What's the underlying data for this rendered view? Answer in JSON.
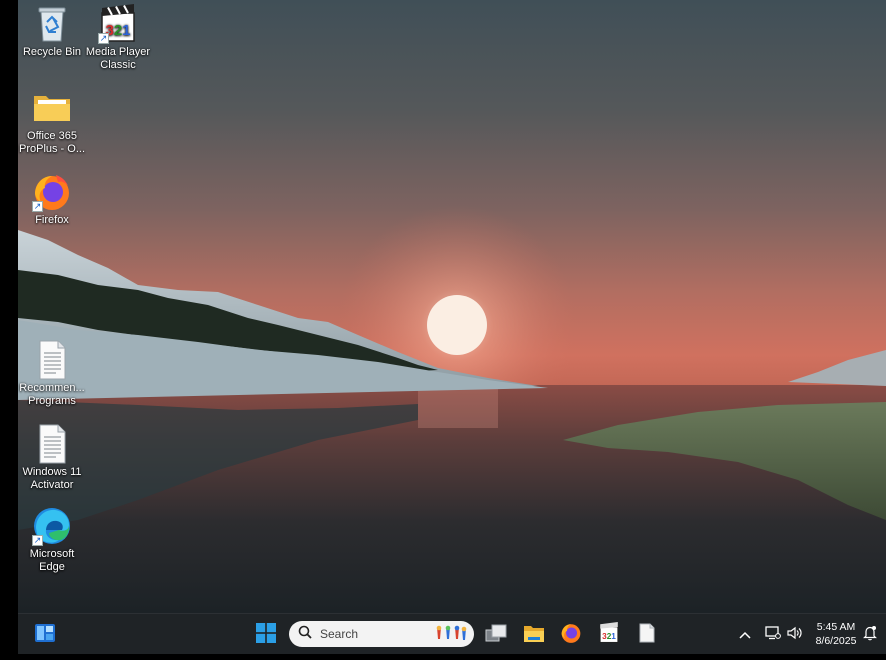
{
  "desktop": {
    "icons": [
      {
        "label": "Recycle Bin",
        "icon": "recycle-bin-icon"
      },
      {
        "label": "Media Player Classic",
        "icon": "media-player-classic-icon"
      },
      {
        "label": "Office 365 ProPlus - O...",
        "icon": "folder-icon"
      },
      {
        "label": "Firefox",
        "icon": "firefox-icon"
      },
      {
        "label": "Recommen... Programs",
        "icon": "text-file-icon"
      },
      {
        "label": "Windows 11 Activator",
        "icon": "text-file-icon"
      },
      {
        "label": "Microsoft Edge",
        "icon": "edge-icon"
      }
    ]
  },
  "taskbar": {
    "widgets_icon": "widgets-icon",
    "start_icon": "windows-start-icon",
    "search": {
      "placeholder": "Search"
    },
    "apps": [
      {
        "icon": "task-view-icon"
      },
      {
        "icon": "file-explorer-icon"
      },
      {
        "icon": "firefox-icon"
      },
      {
        "icon": "media-player-classic-icon"
      },
      {
        "icon": "notepad-file-icon"
      }
    ],
    "tray": {
      "time": "5:45 AM",
      "date": "8/6/2025"
    }
  },
  "colors": {
    "taskbar_bg": "#1f2326",
    "windows_blue": "#2b9fe6"
  }
}
